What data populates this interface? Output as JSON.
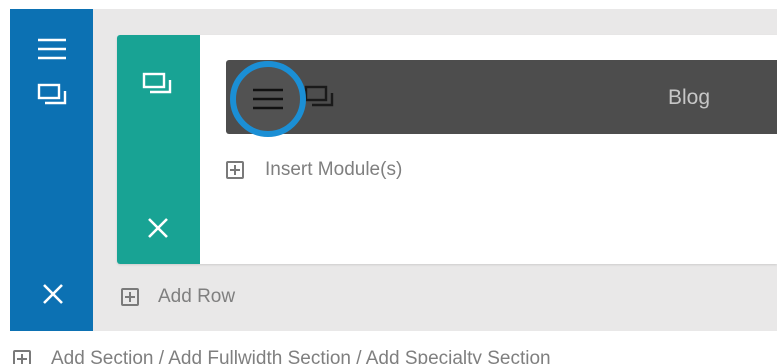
{
  "colors": {
    "section_bar": "#0c71b3",
    "row_bar": "#18a394",
    "module_bar": "#4d4d4d",
    "highlight_ring": "#1b8fd5",
    "canvas": "#e9e8e8"
  },
  "icons": {
    "section": [
      "menu-icon",
      "duplicate-icon",
      "close-icon"
    ],
    "row": [
      "duplicate-icon",
      "close-icon"
    ],
    "module": [
      "menu-icon",
      "duplicate-icon"
    ]
  },
  "module": {
    "title": "Blog"
  },
  "row": {
    "insert_module_label": "Insert Module(s)"
  },
  "section": {
    "add_row_label": "Add Row"
  },
  "footer": {
    "add_section_label": "Add Section / Add Fullwidth Section / Add Specialty Section"
  }
}
